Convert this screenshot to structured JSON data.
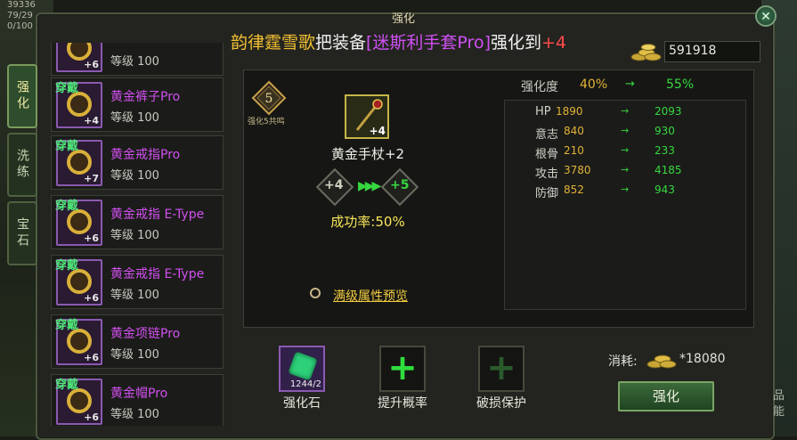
{
  "hud": {
    "stat1": "39336",
    "stat2": "79/29",
    "stat3": "0/100"
  },
  "window": {
    "title": "强化",
    "close_label": "✕"
  },
  "announcement": {
    "player": "韵律霆雪歌",
    "action": "把装备",
    "item": "[迷斯利手套Pro]",
    "result": "强化到",
    "level": "+4"
  },
  "side_tabs": [
    {
      "label": "强化",
      "active": true
    },
    {
      "label": "洗练",
      "active": false
    },
    {
      "label": "宝石",
      "active": false
    }
  ],
  "equipped_badge": "穿戴",
  "items": [
    {
      "name": "",
      "level": "等级 100",
      "plus": "+6",
      "badge": false
    },
    {
      "name": "黄金裤子Pro",
      "level": "等级 100",
      "plus": "+4",
      "badge": true
    },
    {
      "name": "黄金戒指Pro",
      "level": "等级 100",
      "plus": "+7",
      "badge": true
    },
    {
      "name": "黄金戒指 E-Type",
      "level": "等级 100",
      "plus": "+6",
      "badge": true
    },
    {
      "name": "黄金戒指 E-Type",
      "level": "等级 100",
      "plus": "+6",
      "badge": true
    },
    {
      "name": "黄金项链Pro",
      "level": "等级 100",
      "plus": "+6",
      "badge": true
    },
    {
      "name": "黄金帽Pro",
      "level": "等级 100",
      "plus": "+6",
      "badge": true
    }
  ],
  "gold": {
    "amount": "591918"
  },
  "star": {
    "number": "5",
    "caption": "强化5共鸣"
  },
  "equipment": {
    "name": "黄金手杖+2",
    "slot_level": "+4",
    "from_level": "+4",
    "to_level": "+5",
    "success_rate": "成功率:50%",
    "preview_link": "满级属性预览"
  },
  "degree": {
    "label": "强化度",
    "from": "40%",
    "to": "55%",
    "arrow": "→"
  },
  "stats": [
    {
      "name": "HP",
      "from": "1890",
      "to": "2093"
    },
    {
      "name": "意志",
      "from": "840",
      "to": "930"
    },
    {
      "name": "根骨",
      "from": "210",
      "to": "233"
    },
    {
      "name": "攻击",
      "from": "3780",
      "to": "4185"
    },
    {
      "name": "防御",
      "from": "852",
      "to": "943"
    }
  ],
  "stat_arrow": "→",
  "bottom": {
    "stone_label": "强化石",
    "stone_count": "1244/2",
    "rate_label": "提升概率",
    "protect_label": "破损保护",
    "cost_label": "消耗:",
    "cost_value": "*18080",
    "enhance_button": "强化"
  },
  "right_edge": {
    "line1": "品",
    "line2": "能"
  },
  "colors": {
    "accent_green": "#36d640",
    "gold": "#e2b238",
    "purple": "#d24ff0",
    "announce_gold": "#f2c032"
  }
}
